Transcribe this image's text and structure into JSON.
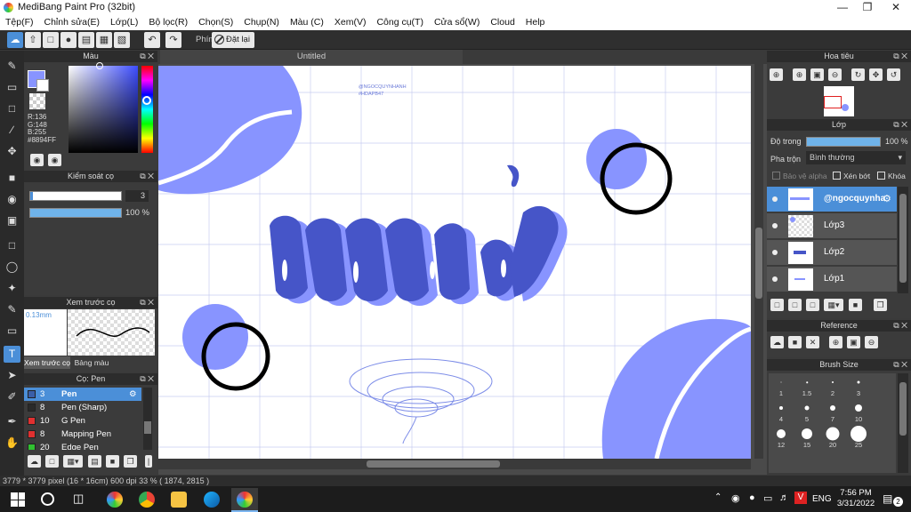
{
  "window": {
    "title": "MediBang Paint Pro (32bit)"
  },
  "menu": [
    "Tệp(F)",
    "Chỉnh sửa(E)",
    "Lớp(L)",
    "Bộ lọc(R)",
    "Chọn(S)",
    "Chụp(N)",
    "Màu (C)",
    "Xem(V)",
    "Công cụ(T)",
    "Cửa sổ(W)",
    "Cloud",
    "Help"
  ],
  "toolbar": {
    "shortcut_label": "Phím",
    "reset_label": "Đặt lại"
  },
  "color_panel": {
    "title": "Màu",
    "r": "R:136",
    "g": "G:148",
    "b": "B:255",
    "hex": "#8894FF",
    "main_color": "#8894FF"
  },
  "brush_control": {
    "title": "Kiểm soát cọ",
    "size": "3",
    "opacity": "100 %"
  },
  "brush_preview": {
    "title": "Xem trước cọ",
    "size": "0.13mm",
    "tab1": "Xem trước cọ",
    "tab2": "Bảng màu"
  },
  "brush_list": {
    "title": "Cọ: Pen",
    "items": [
      {
        "size": "3",
        "name": "Pen",
        "color": "#3a5fa8",
        "selected": true
      },
      {
        "size": "8",
        "name": "Pen (Sharp)",
        "color": "#2a2a2a",
        "selected": false
      },
      {
        "size": "10",
        "name": "G Pen",
        "color": "#e03030",
        "selected": false
      },
      {
        "size": "8",
        "name": "Mapping Pen",
        "color": "#e03030",
        "selected": false
      },
      {
        "size": "20",
        "name": "Edge Pen",
        "color": "#30c030",
        "selected": false
      }
    ]
  },
  "canvas": {
    "tab": "Untitled",
    "watermark_line1": "@NGOCQUYNHANH",
    "watermark_line2": "#HDAPB47"
  },
  "navigator": {
    "title": "Hoa tiêu"
  },
  "layers": {
    "title": "Lớp",
    "opacity_label": "Độ trong",
    "opacity_value": "100 %",
    "blend_label": "Pha trộn",
    "blend_value": "Bình thường",
    "protect_alpha": "Bảo vệ alpha",
    "clipping": "Xén bớt",
    "lock": "Khóa",
    "items": [
      {
        "name": "@ngocquynha",
        "selected": true
      },
      {
        "name": "Lớp3",
        "selected": false
      },
      {
        "name": "Lớp2",
        "selected": false
      },
      {
        "name": "Lớp1",
        "selected": false
      }
    ]
  },
  "reference": {
    "title": "Reference"
  },
  "brush_size": {
    "title": "Brush Size",
    "sizes": [
      "1",
      "1.5",
      "2",
      "3",
      "4",
      "5",
      "7",
      "10",
      "12",
      "15",
      "20",
      "25"
    ]
  },
  "status": {
    "text": "3779 * 3779 pixel   (16 * 16cm)   600 dpi   33 %   ( 1874, 2815 )"
  },
  "taskbar": {
    "lang": "ENG",
    "time": "7:56 PM",
    "date": "3/31/2022",
    "notif": "2"
  }
}
